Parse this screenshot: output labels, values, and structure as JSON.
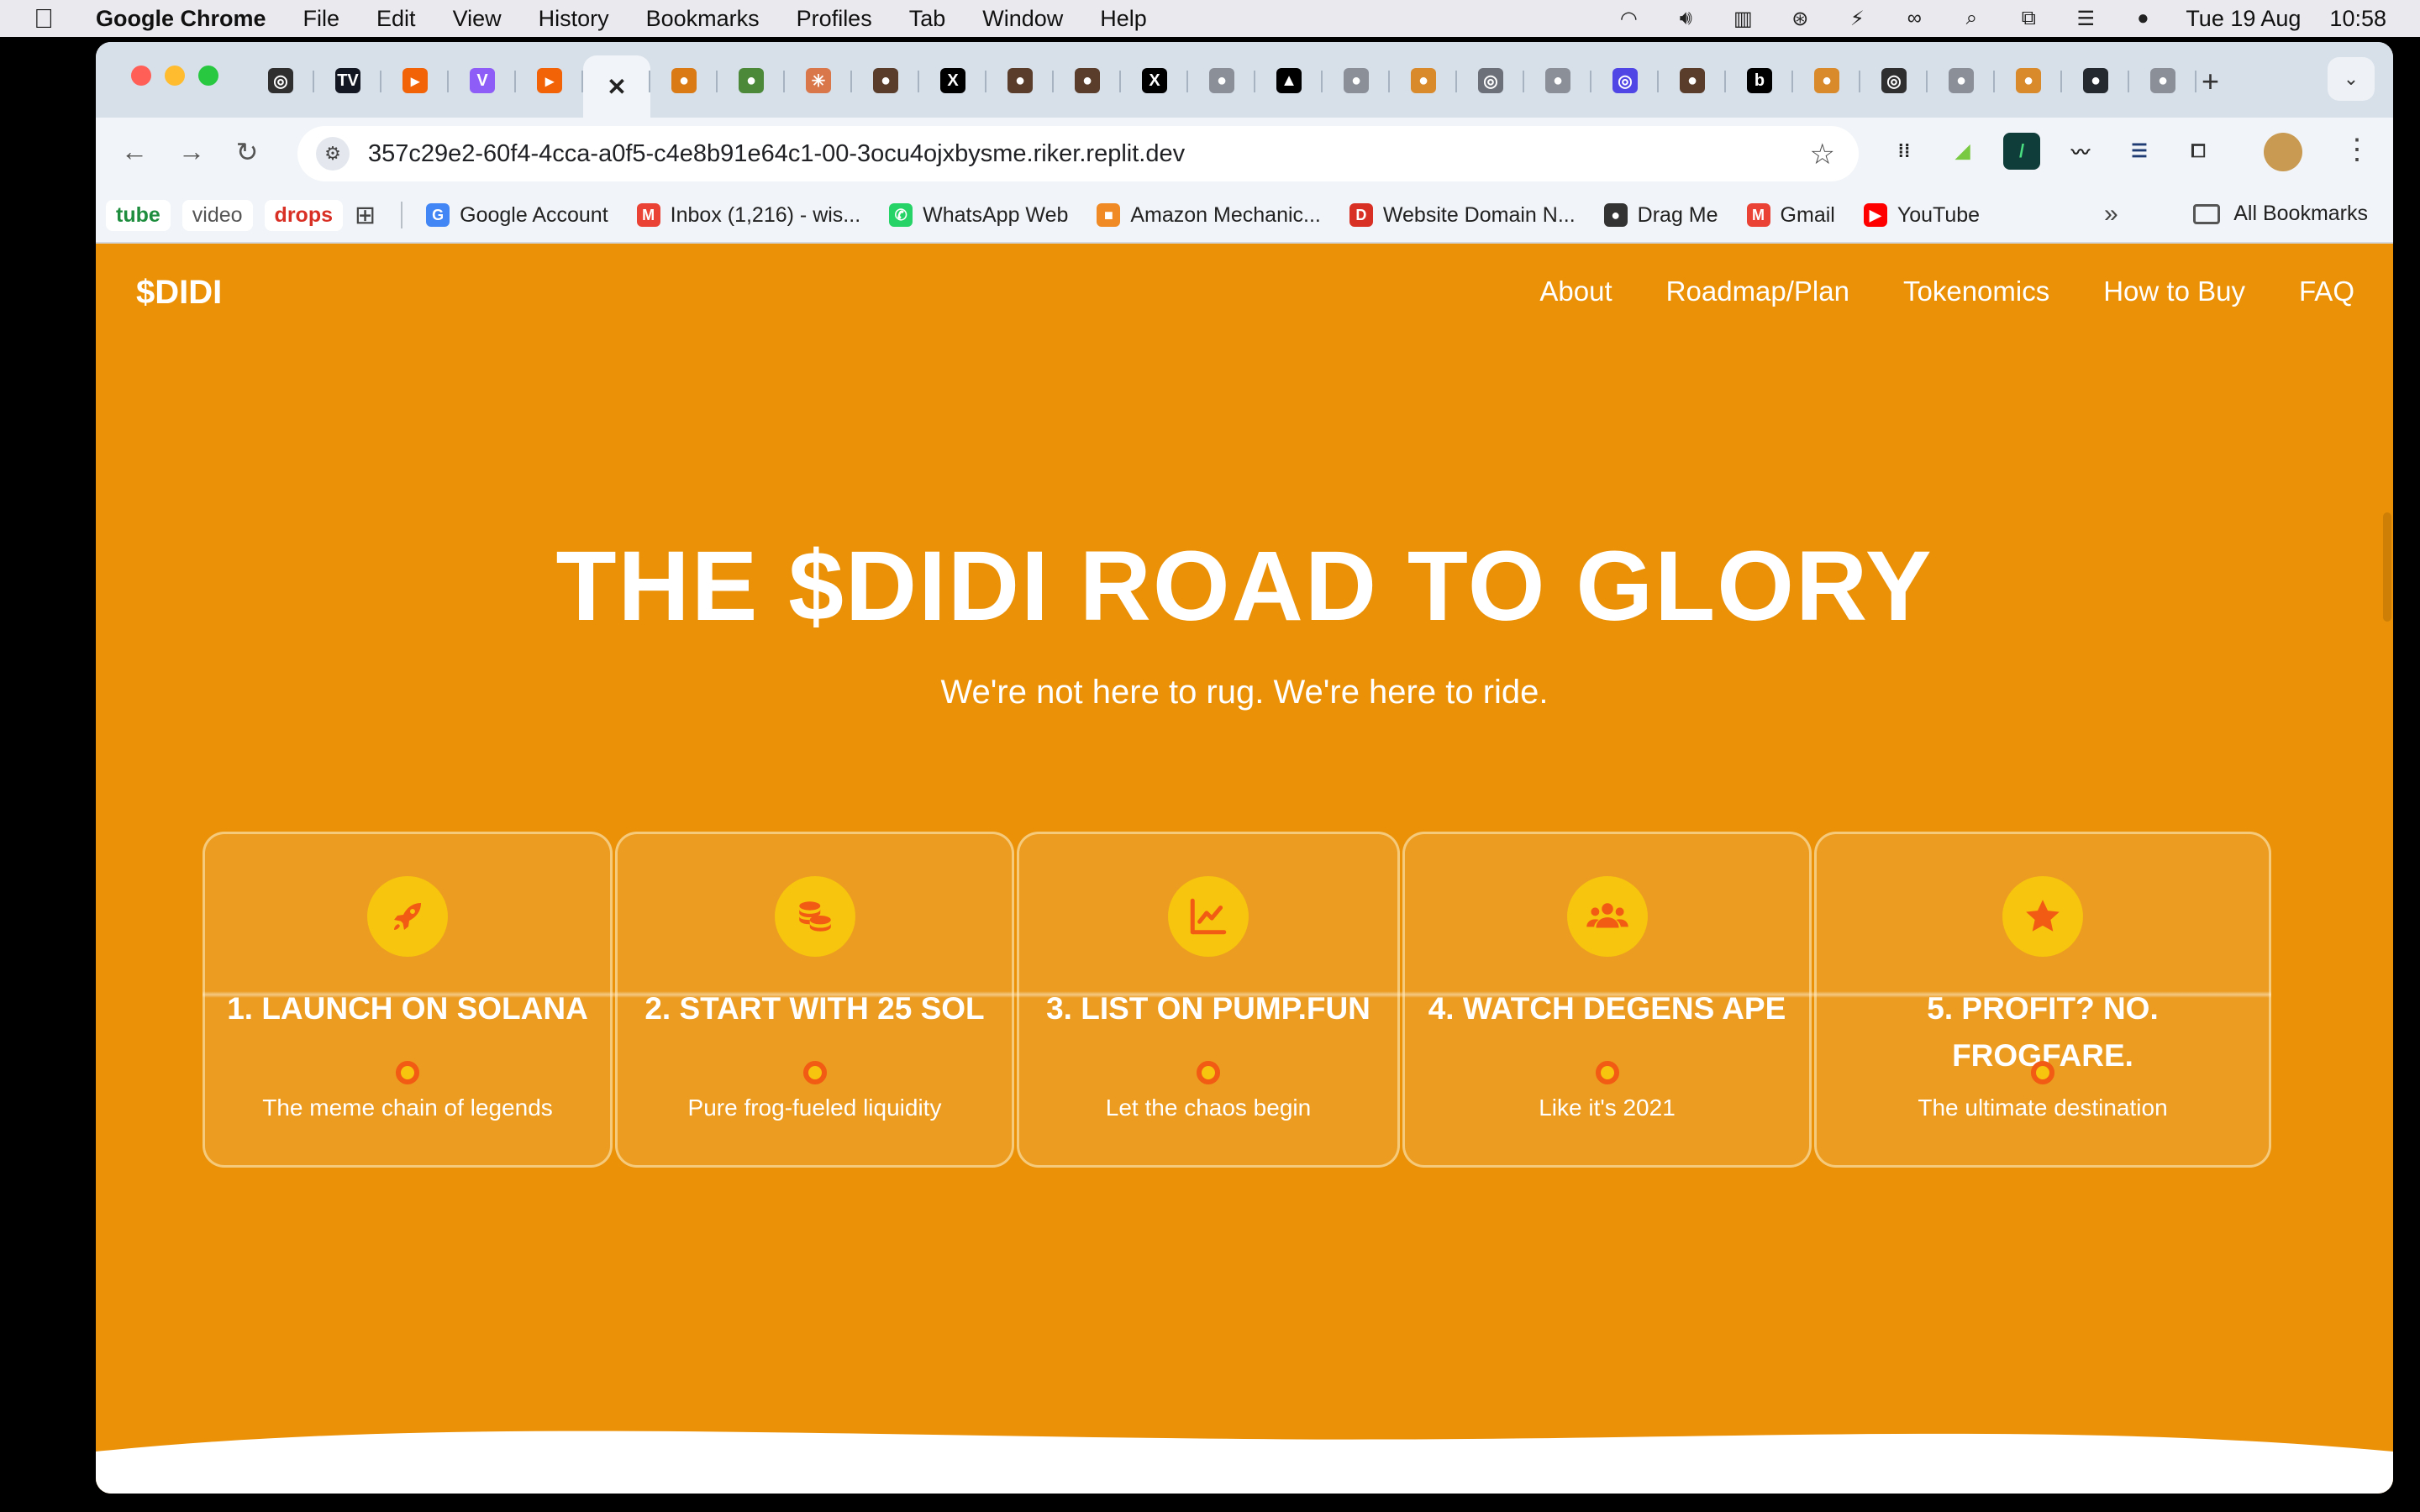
{
  "menubar": {
    "app_name": "Google Chrome",
    "menus": [
      "File",
      "Edit",
      "View",
      "History",
      "Bookmarks",
      "Profiles",
      "Tab",
      "Window",
      "Help"
    ],
    "date": "Tue 19 Aug",
    "time": "10:58",
    "status_icons": [
      "wifi-icon",
      "volume-icon",
      "battery-icon",
      "accessibility-icon",
      "battery-charging-icon",
      "link-icon",
      "search-icon",
      "screen-mirroring-icon",
      "control-center-icon",
      "siri-icon"
    ]
  },
  "browser": {
    "tabs": [
      {
        "icon": "openai-icon",
        "color": "#2f2f2f",
        "glyph": "◎"
      },
      {
        "icon": "tradingview-icon",
        "color": "#131722",
        "glyph": "TV"
      },
      {
        "icon": "replit-icon",
        "color": "#f26207",
        "glyph": "▸"
      },
      {
        "icon": "vite-icon",
        "color": "#8e5cf6",
        "glyph": "V"
      },
      {
        "icon": "replit-icon",
        "color": "#f26207",
        "glyph": "▸"
      },
      {
        "icon": "close-icon",
        "color": "#f1f4f8",
        "glyph": "✕",
        "active": true
      },
      {
        "icon": "didi-frog-icon",
        "color": "#d97a14",
        "glyph": "●"
      },
      {
        "icon": "pepe-icon",
        "color": "#4c8a3a",
        "glyph": "●"
      },
      {
        "icon": "claude-icon",
        "color": "#d9774a",
        "glyph": "✳"
      },
      {
        "icon": "avatar-icon",
        "color": "#5a3e2b",
        "glyph": "●"
      },
      {
        "icon": "x-icon",
        "color": "#000000",
        "glyph": "X"
      },
      {
        "icon": "avatar-icon",
        "color": "#5a3e2b",
        "glyph": "●"
      },
      {
        "icon": "avatar-icon",
        "color": "#5a3e2b",
        "glyph": "●"
      },
      {
        "icon": "x-icon",
        "color": "#000000",
        "glyph": "X"
      },
      {
        "icon": "globe-icon",
        "color": "#8a8f98",
        "glyph": "●"
      },
      {
        "icon": "vercel-icon",
        "color": "#000000",
        "glyph": "▲"
      },
      {
        "icon": "globe-icon",
        "color": "#8a8f98",
        "glyph": "●"
      },
      {
        "icon": "egg-icon",
        "color": "#d98a2b",
        "glyph": "●"
      },
      {
        "icon": "chrome-icon",
        "color": "#6c7078",
        "glyph": "◎"
      },
      {
        "icon": "globe-icon",
        "color": "#8a8f98",
        "glyph": "●"
      },
      {
        "icon": "ring-icon",
        "color": "#4f46e5",
        "glyph": "◎"
      },
      {
        "icon": "avatar-icon",
        "color": "#5a3e2b",
        "glyph": "●"
      },
      {
        "icon": "b-icon",
        "color": "#000000",
        "glyph": "b"
      },
      {
        "icon": "egg-icon",
        "color": "#d98a2b",
        "glyph": "●"
      },
      {
        "icon": "openai-icon",
        "color": "#2f2f2f",
        "glyph": "◎"
      },
      {
        "icon": "globe-icon",
        "color": "#8a8f98",
        "glyph": "●"
      },
      {
        "icon": "egg-icon",
        "color": "#d98a2b",
        "glyph": "●"
      },
      {
        "icon": "github-icon",
        "color": "#24292f",
        "glyph": "●"
      },
      {
        "icon": "globe-icon",
        "color": "#8a8f98",
        "glyph": "●"
      }
    ],
    "url": "357c29e2-60f4-4cca-a0f5-c4e8b91e64c1-00-3ocu4ojxbysme.riker.replit.dev",
    "bookmark_chips": [
      {
        "label": "tube",
        "style": "chip-green"
      },
      {
        "label": "video",
        "style": "chip-gray"
      },
      {
        "label": "drops",
        "style": "chip-red"
      }
    ],
    "bookmarks": [
      {
        "label": "Google Account",
        "icon": "google-icon",
        "color": "#4285f4",
        "glyph": "G"
      },
      {
        "label": "Inbox (1,216) - wis...",
        "icon": "gmail-icon",
        "color": "#ea4335",
        "glyph": "M"
      },
      {
        "label": "WhatsApp Web",
        "icon": "whatsapp-icon",
        "color": "#25d366",
        "glyph": "✆"
      },
      {
        "label": "Amazon Mechanic...",
        "icon": "amazon-mturk-icon",
        "color": "#f08a24",
        "glyph": "■"
      },
      {
        "label": "Website Domain N...",
        "icon": "domain-icon",
        "color": "#d93025",
        "glyph": "D"
      },
      {
        "label": "Drag Me",
        "icon": "globe-icon",
        "color": "#333333",
        "glyph": "●"
      },
      {
        "label": "Gmail",
        "icon": "gmail-icon",
        "color": "#ea4335",
        "glyph": "M"
      },
      {
        "label": "YouTube",
        "icon": "youtube-icon",
        "color": "#ff0000",
        "glyph": "▶"
      }
    ],
    "all_bookmarks": "All Bookmarks"
  },
  "site": {
    "logo": "$DIDI",
    "nav": [
      "About",
      "Roadmap/Plan",
      "Tokenomics",
      "How to Buy",
      "FAQ"
    ],
    "hero_title": "THE $DIDI ROAD TO GLORY",
    "hero_subtitle": "We're not here to rug. We're here to ride.",
    "steps": [
      {
        "title": "1. LAUNCH ON SOLANA",
        "desc": "The meme chain of legends",
        "icon": "rocket-icon"
      },
      {
        "title": "2. START WITH 25 SOL",
        "desc": "Pure frog-fueled liquidity",
        "icon": "coins-icon"
      },
      {
        "title": "3. LIST ON PUMP.FUN",
        "desc": "Let the chaos begin",
        "icon": "chart-line-icon"
      },
      {
        "title": "4. WATCH DEGENS APE",
        "desc": "Like it's 2021",
        "icon": "users-icon"
      },
      {
        "title": "5. PROFIT? NO. FROGFARE.",
        "desc": "The ultimate destination",
        "icon": "star-icon"
      }
    ],
    "colors": {
      "background": "#ea9107",
      "icon_circle": "#f7c40e",
      "accent": "#f15b13"
    }
  }
}
